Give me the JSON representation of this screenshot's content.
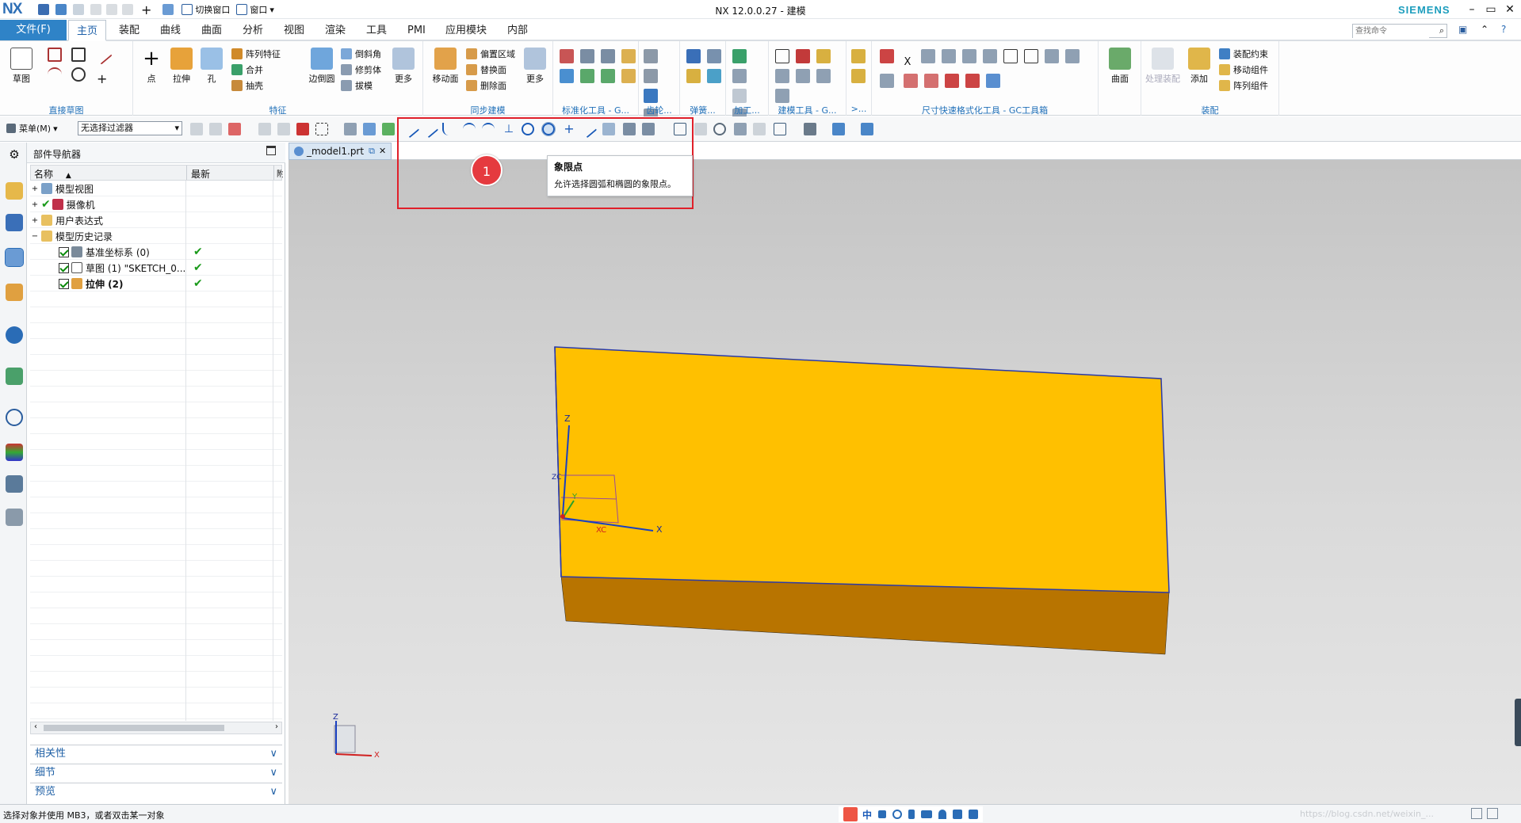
{
  "titlebar": {
    "logo": "NX",
    "switch_window": "切换窗口",
    "window": "窗口",
    "app_title": "NX 12.0.0.27 - 建模",
    "brand": "SIEMENS"
  },
  "menubar": {
    "file": "文件(F)",
    "tabs": [
      "主页",
      "装配",
      "曲线",
      "曲面",
      "分析",
      "视图",
      "渲染",
      "工具",
      "PMI",
      "应用模块",
      "内部"
    ],
    "active_tab": "主页",
    "search_placeholder": "查找命令"
  },
  "ribbon": {
    "groups": {
      "sketch": "直接草图",
      "feature": "特征",
      "sync": "同步建模",
      "std_tools": "标准化工具 - G...",
      "gear": "齿轮...",
      "spring": "弹簧...",
      "machining": "加工...",
      "modeling_tools": "建模工具 - G...",
      "more": ">...",
      "dimension": "尺寸快速格式化工具 - GC工具箱",
      "assembly": "装配"
    },
    "buttons": {
      "sketch": "草图",
      "point": "点",
      "extrude": "拉伸",
      "hole": "孔",
      "pattern_feature": "阵列特征",
      "unite": "合并",
      "shell": "抽壳",
      "edge_blend": "边倒圆",
      "chamfer": "倒斜角",
      "trim_body": "修剪体",
      "draft": "拔模",
      "more": "更多",
      "move_face": "移动面",
      "offset_region": "偏置区域",
      "replace_face": "替换面",
      "delete_face": "删除面",
      "more2": "更多",
      "surface": "曲面",
      "process_assembly": "处理装配",
      "add": "添加",
      "assembly_constraint": "装配约束",
      "move_component": "移动组件",
      "pattern_component": "阵列组件"
    }
  },
  "toolbar2": {
    "menu": "菜单(M)",
    "filter": "无选择过滤器"
  },
  "navigator": {
    "title": "部件导航器",
    "col_name": "名称",
    "col_latest": "最新",
    "col_extra": "附",
    "tree": [
      {
        "label": "模型视图",
        "level": 0,
        "check": false,
        "latest": ""
      },
      {
        "label": "摄像机",
        "level": 0,
        "check": false,
        "latest": ""
      },
      {
        "label": "用户表达式",
        "level": 0,
        "check": false,
        "latest": ""
      },
      {
        "label": "模型历史记录",
        "level": 0,
        "check": false,
        "latest": ""
      },
      {
        "label": "基准坐标系 (0)",
        "level": 1,
        "check": true,
        "latest": "✔"
      },
      {
        "label": "草图 (1) \"SKETCH_0...",
        "level": 1,
        "check": true,
        "latest": "✔"
      },
      {
        "label": "拉伸 (2)",
        "level": 1,
        "check": true,
        "latest": "✔"
      }
    ],
    "panels": [
      "相关性",
      "细节",
      "预览"
    ]
  },
  "document": {
    "tab": "_model1.prt"
  },
  "callout": {
    "number": "1",
    "tooltip_title": "象限点",
    "tooltip_body": "允许选择圆弧和椭圆的象限点。"
  },
  "viewport": {
    "axis_z": "Z",
    "axis_x": "X",
    "axis_xc": "XC",
    "axis_y": "Y",
    "axis_zc": "ZC",
    "part_color": "#ffc000",
    "part_side_color": "#b87400",
    "edge_color": "#2a3aa8"
  },
  "status": {
    "message": "选择对象并使用 MB3，或者双击某一对象",
    "ime": "中",
    "watermark": "https://blog.csdn.net/weixin_..."
  }
}
